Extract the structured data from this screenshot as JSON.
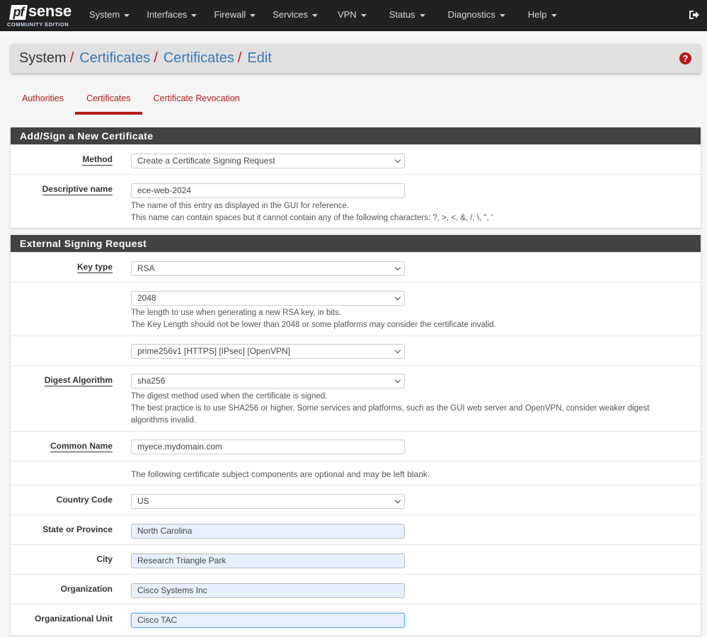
{
  "navbar": {
    "logo": {
      "mark": "pf",
      "word": "sense",
      "edition": "COMMUNITY EDITION"
    },
    "menu": [
      {
        "label": "System"
      },
      {
        "label": "Interfaces"
      },
      {
        "label": "Firewall"
      },
      {
        "label": "Services"
      },
      {
        "label": "VPN"
      },
      {
        "label": "Status"
      },
      {
        "label": "Diagnostics"
      },
      {
        "label": "Help"
      }
    ],
    "logout_icon": "sign-out-icon"
  },
  "breadcrumb": {
    "items": [
      "System",
      "Certificates",
      "Certificates",
      "Edit"
    ],
    "separator": "/",
    "help_icon": "question-circle-icon",
    "help_glyph": "?"
  },
  "tabs": [
    {
      "label": "Authorities",
      "active": false
    },
    {
      "label": "Certificates",
      "active": true
    },
    {
      "label": "Certificate Revocation",
      "active": false
    }
  ],
  "section_add": {
    "title": "Add/Sign a New Certificate",
    "method": {
      "label": "Method",
      "value": "Create a Certificate Signing Request"
    },
    "descriptive_name": {
      "label": "Descriptive name",
      "value": "ece-web-2024",
      "help_1": "The name of this entry as displayed in the GUI for reference.",
      "help_2": "This name can contain spaces but it cannot contain any of the following characters: ?, >, <, &, /, \\, \", '"
    }
  },
  "section_csr": {
    "title": "External Signing Request",
    "key_type": {
      "label": "Key type",
      "value": "RSA"
    },
    "key_length": {
      "value": "2048",
      "help_1": "The length to use when generating a new RSA key, in bits.",
      "help_2": "The Key Length should not be lower than 2048 or some platforms may consider the certificate invalid."
    },
    "ecname": {
      "value": "prime256v1 [HTTPS] [IPsec] [OpenVPN]"
    },
    "digest": {
      "label": "Digest Algorithm",
      "value": "sha256",
      "help_1": "The digest method used when the certificate is signed.",
      "help_2": "The best practice is to use SHA256 or higher. Some services and platforms, such as the GUI web server and OpenVPN, consider weaker digest algorithms invalid."
    },
    "common_name": {
      "label": "Common Name",
      "value": "myece.mydomain.com"
    },
    "optional_note": "The following certificate subject components are optional and may be left blank.",
    "country": {
      "label": "Country Code",
      "value": "US"
    },
    "state": {
      "label": "State or Province",
      "value": "North Carolina"
    },
    "city": {
      "label": "City",
      "value": "Research Triangle Park"
    },
    "organization": {
      "label": "Organization",
      "value": "Cisco Systems Inc"
    },
    "org_unit": {
      "label": "Organizational Unit",
      "value": "Cisco TAC"
    }
  }
}
